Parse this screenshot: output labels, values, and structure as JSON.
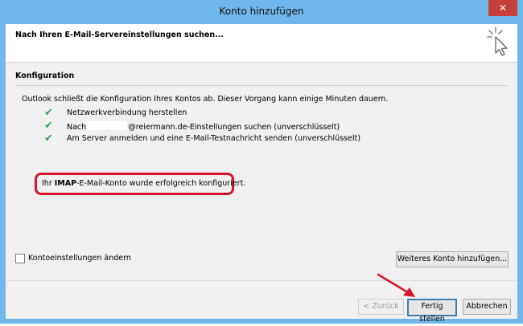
{
  "window": {
    "title": "Konto hinzufügen",
    "close_glyph": "✕"
  },
  "header": {
    "title": "Nach Ihren E-Mail-Servereinstellungen suchen...",
    "icon": "cursor-sparkle-icon"
  },
  "section": {
    "title": "Konfiguration",
    "intro": "Outlook schließt die Konfiguration Ihres Kontos ab. Dieser Vorgang kann einige Minuten dauern.",
    "steps": [
      {
        "status": "done",
        "text": "Netzwerkverbindung herstellen"
      },
      {
        "status": "done",
        "text_prefix": "Nach",
        "text_suffix": "@reiermann.de-Einstellungen suchen (unverschlüsselt)"
      },
      {
        "status": "done",
        "text": "Am Server anmelden und eine E-Mail-Testnachricht senden (unverschlüsselt)"
      }
    ],
    "check_glyph": "✔"
  },
  "result": {
    "prefix": "Ihr ",
    "bold": "IMAP",
    "suffix": "-E-Mail-Konto wurde erfolgreich konfiguriert.",
    "highlight_color": "#d9152b"
  },
  "options": {
    "change_settings_label": "Kontoeinstellungen ändern",
    "change_settings_checked": false,
    "add_another_label": "Weiteres Konto hinzufügen..."
  },
  "footer": {
    "back_label": "< Zurück",
    "finish_label": "Fertig stellen",
    "cancel_label": "Abbrechen"
  },
  "colors": {
    "titlebar": "#6fb7ec",
    "check": "#3aa24a",
    "annotation_arrow": "#d9152b"
  }
}
